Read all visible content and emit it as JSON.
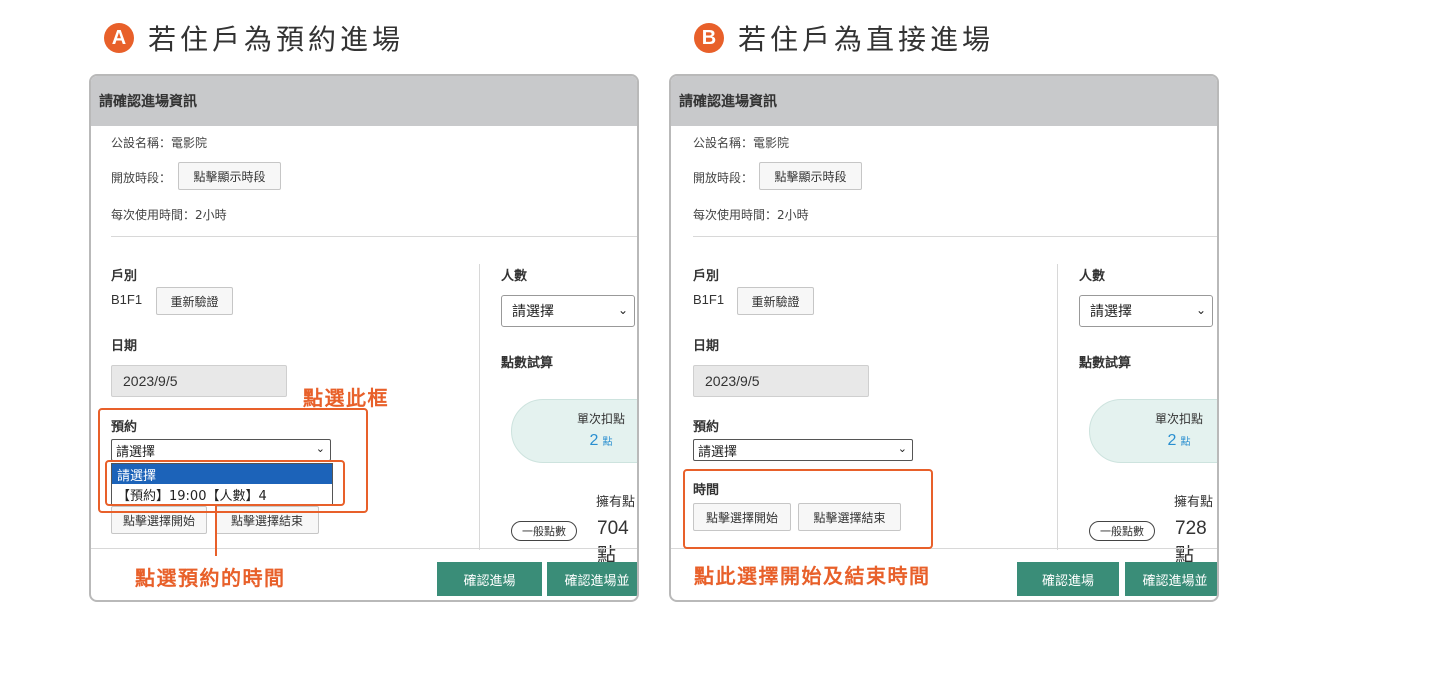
{
  "panels": [
    {
      "badge": "A",
      "heading": "若住戶為預約進場",
      "header_title": "請確認進場資訊",
      "facility": "公設名稱：電影院",
      "open_hours_label": "開放時段：",
      "open_hours_button": "點擊顯示時段",
      "usage_time": "每次使用時間：2小時",
      "household_label": "戶別",
      "household_value": "B1F1",
      "reverify_button": "重新驗證",
      "date_label": "日期",
      "date_value": "2023/9/5",
      "reservation_label": "預約",
      "reservation_select": "請選擇",
      "dropdown_options": [
        "請選擇",
        "【預約】19:00【人數】4"
      ],
      "start_button": "點擊選擇開始",
      "end_button": "點擊選擇結束",
      "people_label": "人數",
      "people_select": "請選擇",
      "points_calc_label": "點數試算",
      "per_use_caption": "單次扣點",
      "per_use_value": "2",
      "per_use_unit": "點",
      "owned_label": "擁有點",
      "point_type": "一般點數",
      "owned_value": "704",
      "owned_unit": "點",
      "confirm_button": "確認進場",
      "confirm_plus_button": "確認進場並",
      "callout_select": "點選此框",
      "callout_time": "點選預約的時間"
    },
    {
      "badge": "B",
      "heading": "若住戶為直接進場",
      "header_title": "請確認進場資訊",
      "facility": "公設名稱：電影院",
      "open_hours_label": "開放時段：",
      "open_hours_button": "點擊顯示時段",
      "usage_time": "每次使用時間：2小時",
      "household_label": "戶別",
      "household_value": "B1F1",
      "reverify_button": "重新驗證",
      "date_label": "日期",
      "date_value": "2023/9/5",
      "reservation_label": "預約",
      "reservation_select": "請選擇",
      "time_label": "時間",
      "start_button": "點擊選擇開始",
      "end_button": "點擊選擇結束",
      "people_label": "人數",
      "people_select": "請選擇",
      "points_calc_label": "點數試算",
      "per_use_caption": "單次扣點",
      "per_use_value": "2",
      "per_use_unit": "點",
      "owned_label": "擁有點",
      "point_type": "一般點數",
      "owned_value": "728",
      "owned_unit": "點",
      "confirm_button": "確認進場",
      "confirm_plus_button": "確認進場並",
      "callout_time": "點此選擇開始及結束時間"
    }
  ],
  "colors": {
    "accent_orange": "#e8602a",
    "confirm_green": "#3a8d78",
    "header_gray": "#c8c9cb",
    "pill_teal": "#e4f2ef",
    "points_blue": "#2a8fd0",
    "selected_option_blue": "#1c63b9"
  },
  "icons": {
    "select_caret": "chevron-down-icon"
  }
}
